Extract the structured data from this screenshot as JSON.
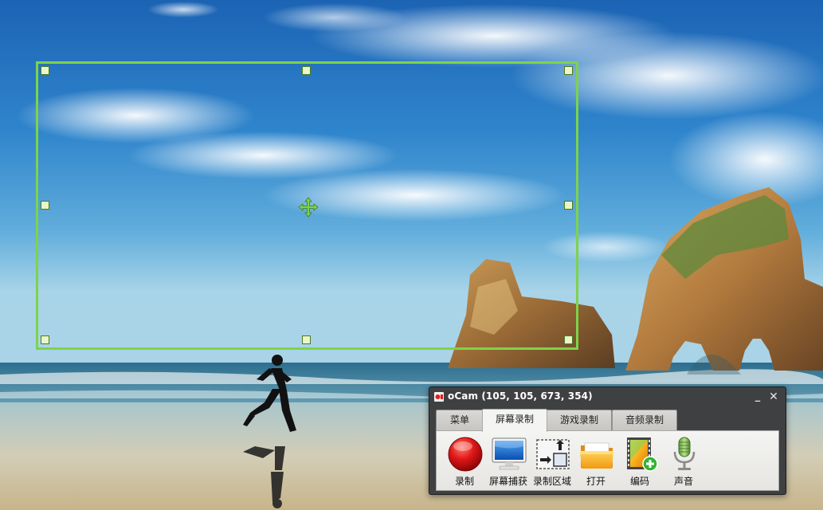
{
  "window": {
    "title": "oCam (105, 105, 673, 354)",
    "minimize_label": "_",
    "close_label": "✕"
  },
  "tabs": [
    {
      "label": "菜单",
      "active": false
    },
    {
      "label": "屏幕录制",
      "active": true
    },
    {
      "label": "游戏录制",
      "active": false
    },
    {
      "label": "音频录制",
      "active": false
    }
  ],
  "toolbar": [
    {
      "label": "录制",
      "icon": "record-icon"
    },
    {
      "label": "屏幕捕获",
      "icon": "monitor-icon"
    },
    {
      "label": "录制区域",
      "icon": "resize-region-icon"
    },
    {
      "label": "打开",
      "icon": "folder-icon"
    },
    {
      "label": "编码",
      "icon": "film-add-icon"
    },
    {
      "label": "声音",
      "icon": "microphone-icon"
    }
  ],
  "colors": {
    "region_border": "#7ed34a",
    "window_frame": "#3f4042",
    "record_red": "#d61414"
  }
}
